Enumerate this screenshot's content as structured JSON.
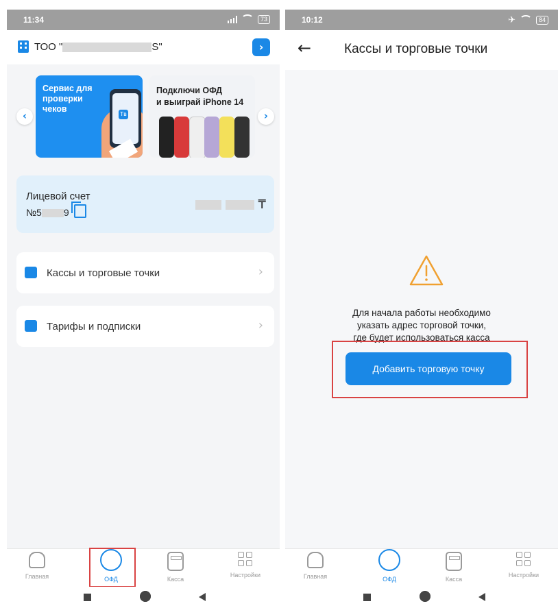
{
  "top_crop_text": "",
  "left": {
    "status": {
      "time": "11:34",
      "battery": "73"
    },
    "header": {
      "company_prefix": "ТОО \"",
      "company_suffix": "S\"",
      "action_icon": "chevron-right-icon"
    },
    "carousel": {
      "card1": {
        "line1": "Сервис для",
        "line2": "проверки",
        "line3": "чеков",
        "badge": "Тв"
      },
      "card2": {
        "line1": "Подключи ОФД",
        "line2": "и выиграй iPhone 14"
      },
      "prev": "‹",
      "next": "›"
    },
    "account": {
      "title": "Лицевой счет",
      "number_prefix": "№5",
      "number_suffix": "9",
      "currency": "₸"
    },
    "menu": [
      {
        "label": "Кассы и торговые точки",
        "icon": "cash-register-icon"
      },
      {
        "label": "Тарифы и подписки",
        "icon": "wallet-icon"
      }
    ],
    "tabs": [
      {
        "label": "Главная",
        "icon": "home-icon"
      },
      {
        "label": "ОФД",
        "icon": "ofd-circle-icon",
        "active": true
      },
      {
        "label": "Касса",
        "icon": "calculator-icon"
      },
      {
        "label": "Настройки",
        "icon": "grid-icon"
      }
    ]
  },
  "right": {
    "status": {
      "time": "10:12",
      "battery": "84"
    },
    "header": {
      "title": "Кассы и торговые точки",
      "back": "←"
    },
    "message": {
      "line1": "Для начала работы необходимо",
      "line2": "указать адрес торговой точки,",
      "line3": "где будет использоваться касса"
    },
    "button": "Добавить торговую точку",
    "tabs": [
      {
        "label": "Главная"
      },
      {
        "label": "ОФД",
        "active": true
      },
      {
        "label": "Касса"
      },
      {
        "label": "Настройки"
      }
    ]
  },
  "colors": {
    "accent": "#1a88e6",
    "highlight": "#d94343",
    "warning": "#f0a030"
  }
}
